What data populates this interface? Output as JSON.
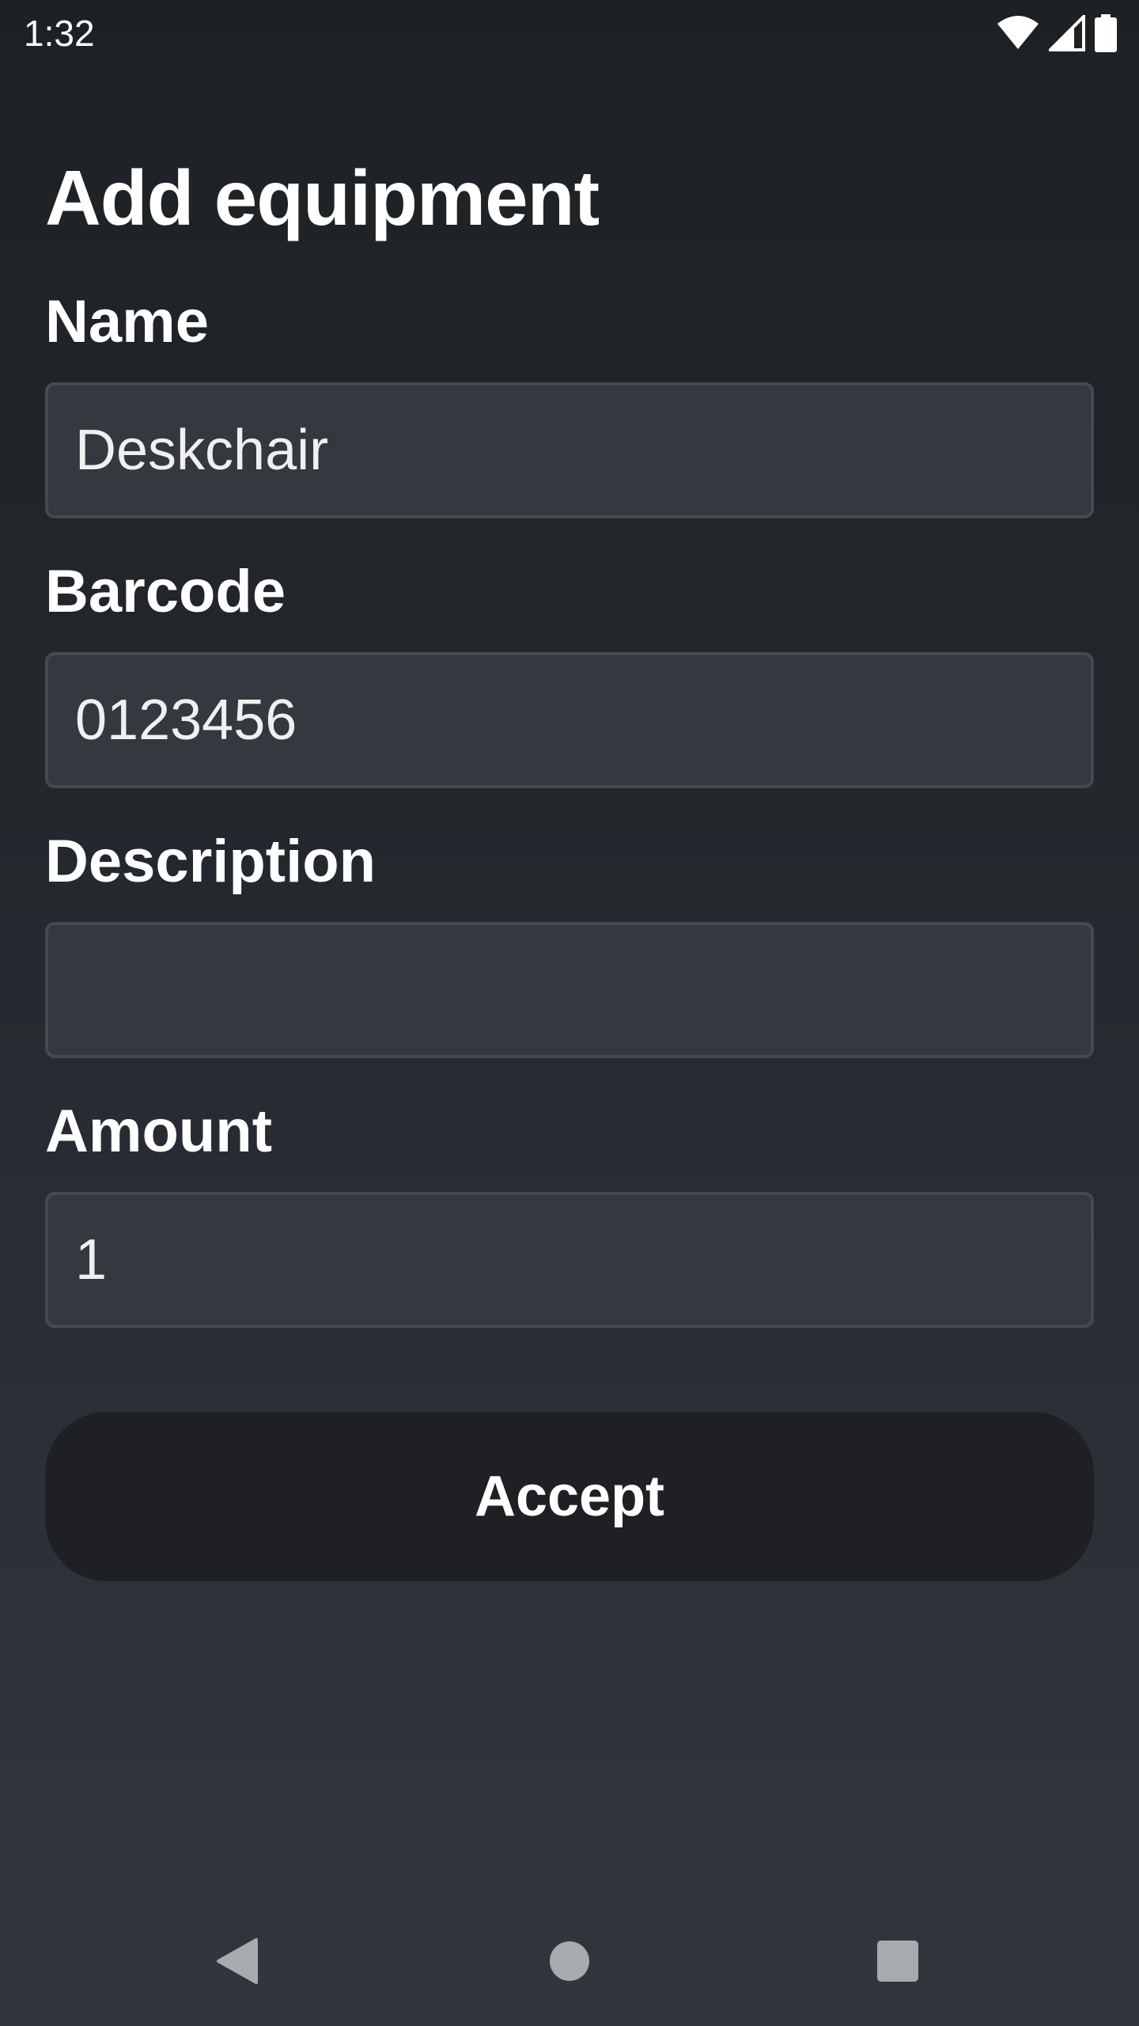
{
  "status_bar": {
    "time": "1:32",
    "icons": [
      "wifi-icon",
      "cellular-signal-icon",
      "battery-icon"
    ]
  },
  "page": {
    "title": "Add equipment"
  },
  "form": {
    "name": {
      "label": "Name",
      "value": "Deskchair"
    },
    "barcode": {
      "label": "Barcode",
      "value": "0123456"
    },
    "description": {
      "label": "Description",
      "value": ""
    },
    "amount": {
      "label": "Amount",
      "value": "1"
    }
  },
  "actions": {
    "accept_label": "Accept"
  },
  "nav_bar": {
    "icons": [
      "back-icon",
      "home-icon",
      "recents-icon"
    ]
  },
  "colors": {
    "background_top": "#1e2124",
    "background_bottom": "#31363c",
    "input_background": "#33393f",
    "input_border": "#454a4f",
    "button_background": "#1e2023",
    "nav_icon": "#a8abae",
    "text": "#ffffff"
  }
}
